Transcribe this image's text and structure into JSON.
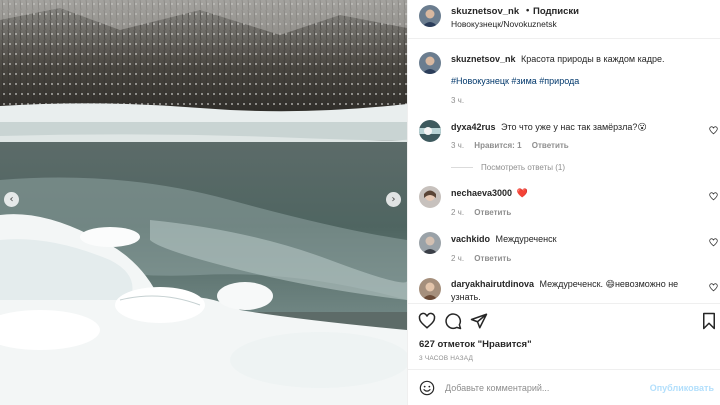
{
  "post": {
    "author": "skuznetsov_nk",
    "follow_separator": "•",
    "follow_label": "Подписки",
    "location": "Новокузнецк/Novokuznetsk"
  },
  "photo": {
    "prev_icon": "chevron-left-icon",
    "next_icon": "chevron-right-icon",
    "prev_glyph": "‹",
    "next_glyph": "›"
  },
  "caption": {
    "user": "skuznetsov_nk",
    "text": "Красота природы в каждом кадре.",
    "hashtags": "#Новокузнецк #зима #природа",
    "time": "3 ч."
  },
  "comments": [
    {
      "user": "dyxa42rus",
      "text": "Это что уже у нас так замёрзла?",
      "emoji": "😮",
      "time": "3 ч.",
      "likes": "Нравится: 1",
      "reply": "Ответить",
      "view_replies": "Посмотреть ответы (1)"
    },
    {
      "user": "nechaeva3000",
      "text": "",
      "emoji": "❤️",
      "time": "2 ч.",
      "reply": "Ответить"
    },
    {
      "user": "vachkido",
      "text": "Междуреченск",
      "time": "2 ч.",
      "reply": "Ответить"
    },
    {
      "user": "daryakhairutdinova",
      "text": "Междуреченск. ",
      "emoji": "😄",
      "text2": "невозможно не",
      "text3": "узнать."
    }
  ],
  "actions": {
    "likes": "627 отметок \"Нравится\"",
    "time_ago": "3 ЧАСОВ НАЗАД"
  },
  "add_comment": {
    "placeholder": "Добавьте комментарий...",
    "publish_label": "Опубликовать"
  },
  "colors": {
    "link": "#00376b",
    "muted": "#8e8e8e",
    "publish_disabled": "#b2dffc",
    "heart": "#ed4956"
  }
}
